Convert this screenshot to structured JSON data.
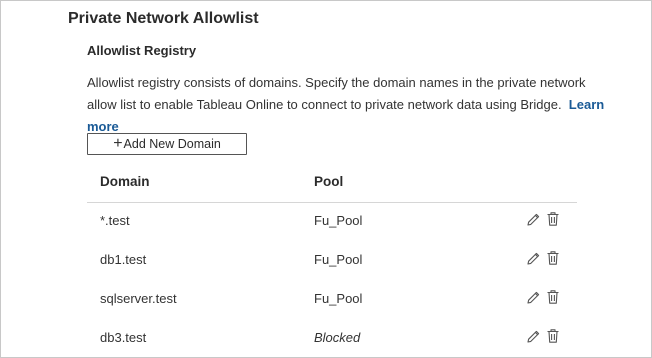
{
  "page": {
    "title": "Private Network Allowlist",
    "section_title": "Allowlist Registry",
    "description_line1": "Allowlist registry consists of domains. Specify the domain names in the private network",
    "description_line2": "allow list to enable Tableau Online to connect to private network data using Bridge.",
    "learn_label": "Learn",
    "more_label": "more",
    "add_button_label": "Add New Domain",
    "add_button_icon": "plus-icon"
  },
  "table": {
    "columns": {
      "domain": "Domain",
      "pool": "Pool"
    },
    "rows": [
      {
        "domain": "*.test",
        "pool": "Fu_Pool",
        "blocked": false
      },
      {
        "domain": "db1.test",
        "pool": "Fu_Pool",
        "blocked": false
      },
      {
        "domain": "sqlserver.test",
        "pool": "Fu_Pool",
        "blocked": false
      },
      {
        "domain": "db3.test",
        "pool": "Blocked",
        "blocked": true
      }
    ],
    "row_actions": [
      "pencil-icon",
      "trash-icon"
    ]
  },
  "colors": {
    "link": "#1a5a96",
    "text": "#333333",
    "border": "#c8c8c8"
  }
}
